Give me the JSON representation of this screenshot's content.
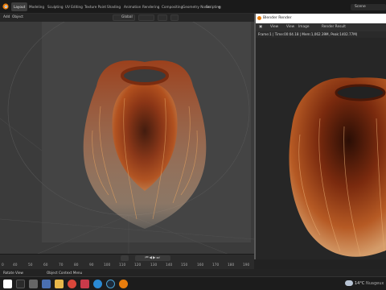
{
  "colors": {
    "accent": "#e87d0d",
    "hair_dark": "#5a1d08",
    "hair_mid": "#b0461a",
    "hair_light": "#e2a060",
    "viewport_bg": "#444444",
    "taskbar_bg": "#1c1c1c"
  },
  "topbar": {
    "tabs": [
      "Layout",
      "Modeling",
      "Sculpting",
      "UV Editing",
      "Texture Paint",
      "Shading",
      "Animation",
      "Rendering",
      "Compositing",
      "Geometry Nodes",
      "Scripting"
    ],
    "active_tab": "Layout",
    "scene_label": "Scene"
  },
  "viewport_header": {
    "add_label": "Add",
    "object_label": "Object",
    "transform_label": "Global"
  },
  "render_window": {
    "title": "Blender Render",
    "menu": [
      "View",
      "View",
      "Image"
    ],
    "slot_label": "Render Result",
    "status": "Frame:1 | Time:00:04.18 | Mem:1,062.39M, Peak:1402.77M)"
  },
  "timeline": {
    "frames": [
      "0",
      "40",
      "50",
      "60",
      "70",
      "80",
      "90",
      "100",
      "110",
      "120",
      "130",
      "140",
      "150",
      "160",
      "170",
      "180",
      "190"
    ],
    "current_frame": "1"
  },
  "statusbar": {
    "left_text": "Rotate View",
    "context_text": "Object Context Menu"
  },
  "taskbar": {
    "apps": [
      "start-icon",
      "search-icon",
      "file-explorer-icon",
      "photos-icon",
      "folder-icon",
      "chrome-icon",
      "vivaldi-icon",
      "edge-icon",
      "app-c-icon",
      "blender-icon"
    ],
    "weather_temp": "14°C",
    "weather_desc": "Nuageux"
  }
}
